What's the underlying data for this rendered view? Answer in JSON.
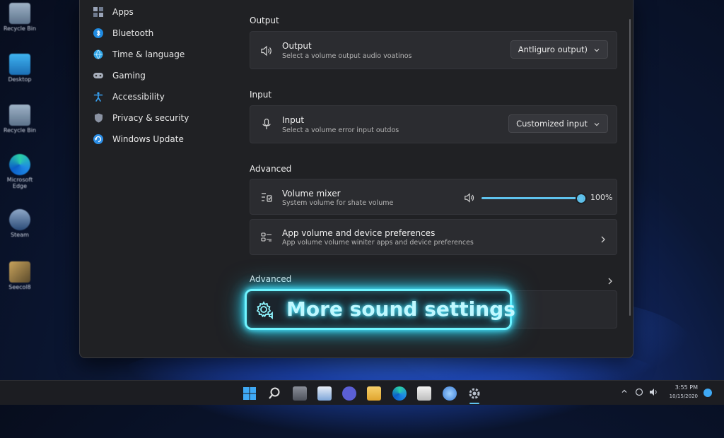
{
  "desktop": {
    "icons": [
      {
        "label": "Recycle Bin"
      },
      {
        "label": "Desktop"
      },
      {
        "label": "Recycle Bin"
      },
      {
        "label": "Microsoft Edge"
      },
      {
        "label": "Steam"
      },
      {
        "label": "Seecol8"
      }
    ]
  },
  "sidebar": {
    "items": [
      {
        "label": "Apps",
        "icon": "apps-icon"
      },
      {
        "label": "Bluetooth",
        "icon": "bluetooth-icon"
      },
      {
        "label": "Time & language",
        "icon": "globe-icon"
      },
      {
        "label": "Gaming",
        "icon": "gamepad-icon"
      },
      {
        "label": "Accessibility",
        "icon": "accessibility-icon"
      },
      {
        "label": "Privacy & security",
        "icon": "shield-icon"
      },
      {
        "label": "Windows Update",
        "icon": "update-icon"
      }
    ]
  },
  "output": {
    "section_title": "Output",
    "title": "Output",
    "subtitle": "Select a volume output audio voatinos",
    "dropdown_value": "Antliguro output)"
  },
  "input": {
    "section_title": "Input",
    "title": "Input",
    "subtitle": "Select a volume error input outdos",
    "dropdown_value": "Customized input"
  },
  "advanced": {
    "section_title": "Advanced",
    "volume_mixer": {
      "title": "Volume mixer",
      "subtitle": "System volume for shate volume",
      "value_label": "100%",
      "value": 100
    },
    "app_prefs": {
      "title": "App volume and device preferences",
      "subtitle": "App volume volume winiter apps and device preferences"
    },
    "section2_title": "Advanced"
  },
  "highlight": {
    "label": "More sound settings",
    "color": "#6ff4ff"
  },
  "tray": {
    "time": "3:55 PM",
    "date": "10/15/2020"
  },
  "colors": {
    "accent": "#5fc3ee",
    "card_bg": "#2b2c30",
    "window_bg": "#202124"
  }
}
